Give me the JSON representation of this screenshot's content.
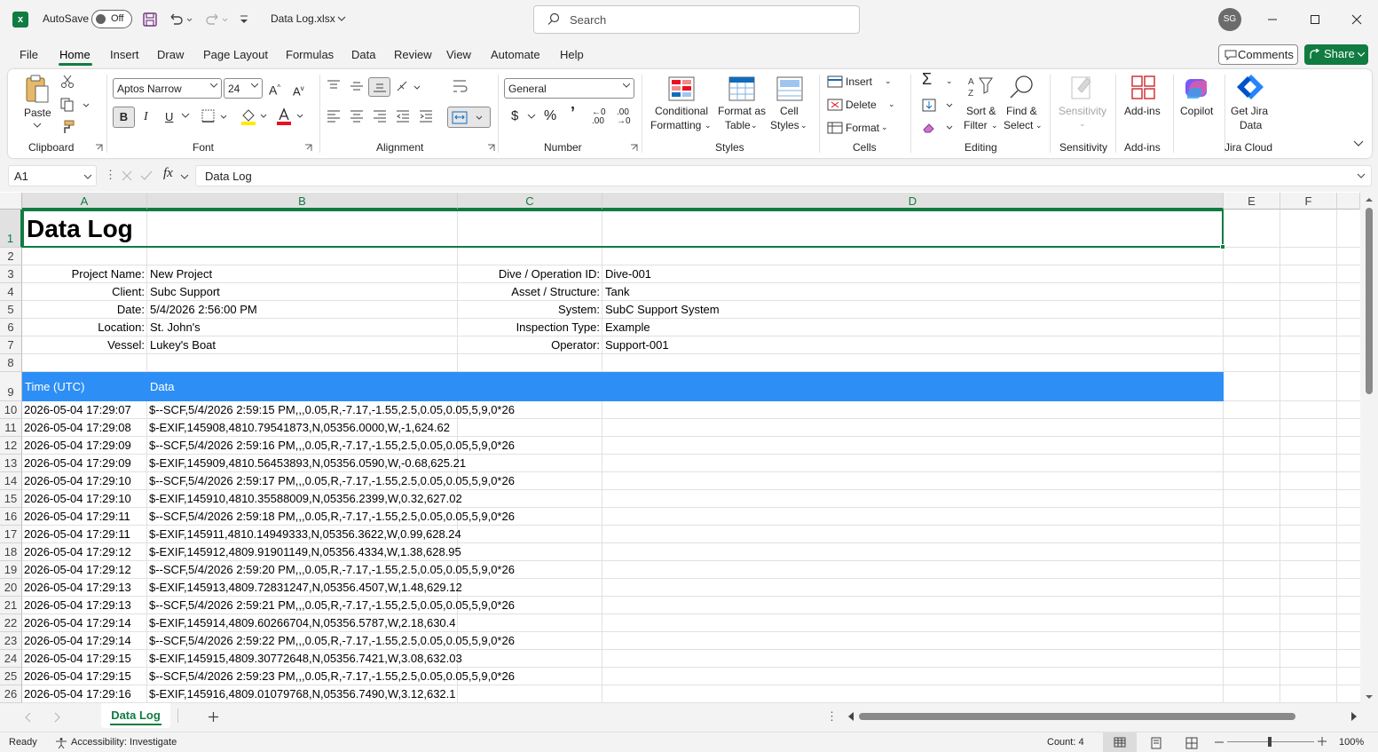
{
  "titlebar": {
    "autosave_label": "AutoSave",
    "autosave_state": "Off",
    "file_name": "Data Log.xlsx",
    "search_placeholder": "Search",
    "avatar_initials": "SG"
  },
  "menu_tabs": [
    "File",
    "Home",
    "Insert",
    "Draw",
    "Page Layout",
    "Formulas",
    "Data",
    "Review",
    "View",
    "Automate",
    "Help"
  ],
  "active_tab": "Home",
  "comments_label": "Comments",
  "share_label": "Share",
  "ribbon": {
    "clipboard": {
      "paste": "Paste",
      "group": "Clipboard"
    },
    "font": {
      "family": "Aptos Narrow",
      "size": "24",
      "group": "Font",
      "bold": "B",
      "italic": "I",
      "underline": "U"
    },
    "alignment": {
      "group": "Alignment"
    },
    "number": {
      "format": "General",
      "group": "Number"
    },
    "styles": {
      "cond1": "Conditional",
      "cond2": "Formatting",
      "fmt1": "Format as",
      "fmt2": "Table",
      "cell1": "Cell",
      "cell2": "Styles",
      "group": "Styles"
    },
    "cells": {
      "insert": "Insert",
      "delete": "Delete",
      "format": "Format",
      "group": "Cells"
    },
    "editing": {
      "sort1": "Sort &",
      "sort2": "Filter",
      "find1": "Find &",
      "find2": "Select",
      "group": "Editing"
    },
    "sensitivity": {
      "label": "Sensitivity",
      "group": "Sensitivity"
    },
    "addins": {
      "label": "Add-ins",
      "group": "Add-ins"
    },
    "copilot": {
      "label": "Copilot"
    },
    "jira": {
      "label1": "Get Jira",
      "label2": "Data",
      "group": "Jira Cloud"
    }
  },
  "formula_bar": {
    "name_box": "A1",
    "formula": "Data Log"
  },
  "columns": [
    "A",
    "B",
    "C",
    "D",
    "E",
    "F"
  ],
  "sheet": {
    "title": "Data Log",
    "info_left": [
      {
        "label": "Project Name:",
        "value": "New Project"
      },
      {
        "label": "Client:",
        "value": "Subc Support"
      },
      {
        "label": "Date:",
        "value": "5/4/2026 2:56:00 PM"
      },
      {
        "label": "Location:",
        "value": "St. John's"
      },
      {
        "label": "Vessel:",
        "value": "Lukey's Boat"
      }
    ],
    "info_right": [
      {
        "label": "Dive / Operation ID:",
        "value": "Dive-001"
      },
      {
        "label": "Asset / Structure:",
        "value": "Tank"
      },
      {
        "label": "System:",
        "value": "SubC Support System"
      },
      {
        "label": "Inspection Type:",
        "value": "Example"
      },
      {
        "label": "Operator:",
        "value": "Support-001"
      }
    ],
    "table_header": {
      "time": "Time (UTC)",
      "data": "Data"
    },
    "rows": [
      [
        "2026-05-04 17:29:07",
        "$--SCF,5/4/2026 2:59:15 PM,,,0.05,R,-7.17,-1.55,2.5,0.05,0.05,5,9,0*26"
      ],
      [
        "2026-05-04 17:29:08",
        "$-EXIF,145908,4810.79541873,N,05356.0000,W,-1,624.62"
      ],
      [
        "2026-05-04 17:29:09",
        "$--SCF,5/4/2026 2:59:16 PM,,,0.05,R,-7.17,-1.55,2.5,0.05,0.05,5,9,0*26"
      ],
      [
        "2026-05-04 17:29:09",
        "$-EXIF,145909,4810.56453893,N,05356.0590,W,-0.68,625.21"
      ],
      [
        "2026-05-04 17:29:10",
        "$--SCF,5/4/2026 2:59:17 PM,,,0.05,R,-7.17,-1.55,2.5,0.05,0.05,5,9,0*26"
      ],
      [
        "2026-05-04 17:29:10",
        "$-EXIF,145910,4810.35588009,N,05356.2399,W,0.32,627.02"
      ],
      [
        "2026-05-04 17:29:11",
        "$--SCF,5/4/2026 2:59:18 PM,,,0.05,R,-7.17,-1.55,2.5,0.05,0.05,5,9,0*26"
      ],
      [
        "2026-05-04 17:29:11",
        "$-EXIF,145911,4810.14949333,N,05356.3622,W,0.99,628.24"
      ],
      [
        "2026-05-04 17:29:12",
        "$-EXIF,145912,4809.91901149,N,05356.4334,W,1.38,628.95"
      ],
      [
        "2026-05-04 17:29:12",
        "$--SCF,5/4/2026 2:59:20 PM,,,0.05,R,-7.17,-1.55,2.5,0.05,0.05,5,9,0*26"
      ],
      [
        "2026-05-04 17:29:13",
        "$-EXIF,145913,4809.72831247,N,05356.4507,W,1.48,629.12"
      ],
      [
        "2026-05-04 17:29:13",
        "$--SCF,5/4/2026 2:59:21 PM,,,0.05,R,-7.17,-1.55,2.5,0.05,0.05,5,9,0*26"
      ],
      [
        "2026-05-04 17:29:14",
        "$-EXIF,145914,4809.60266704,N,05356.5787,W,2.18,630.4"
      ],
      [
        "2026-05-04 17:29:14",
        "$--SCF,5/4/2026 2:59:22 PM,,,0.05,R,-7.17,-1.55,2.5,0.05,0.05,5,9,0*26"
      ],
      [
        "2026-05-04 17:29:15",
        "$-EXIF,145915,4809.30772648,N,05356.7421,W,3.08,632.03"
      ],
      [
        "2026-05-04 17:29:15",
        "$--SCF,5/4/2026 2:59:23 PM,,,0.05,R,-7.17,-1.55,2.5,0.05,0.05,5,9,0*26"
      ],
      [
        "2026-05-04 17:29:16",
        "$-EXIF,145916,4809.01079768,N,05356.7490,W,3.12,632.1"
      ]
    ],
    "header_color": "#2d8ff5"
  },
  "sheet_tab": "Data Log",
  "status": {
    "ready": "Ready",
    "accessibility": "Accessibility: Investigate",
    "count": "Count: 4",
    "zoom": "100%"
  },
  "accent": "#107c41"
}
